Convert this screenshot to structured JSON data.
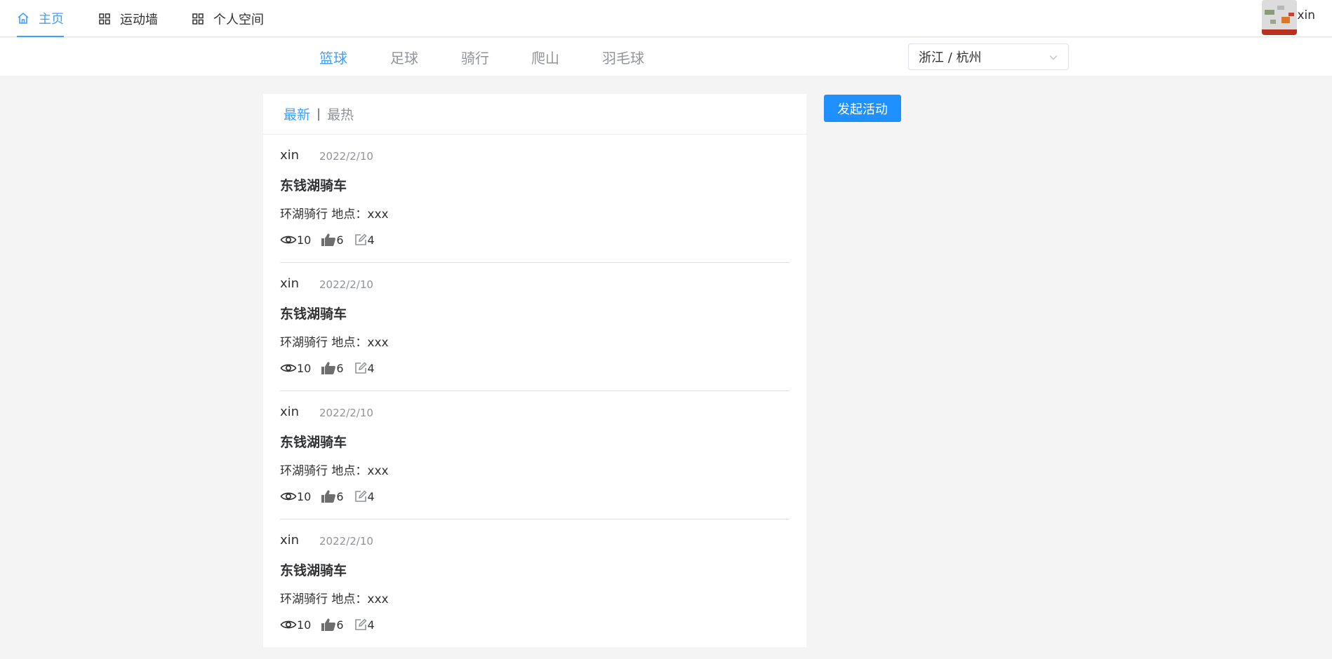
{
  "nav": {
    "items": [
      {
        "label": "主页",
        "icon": "home-icon",
        "active": true
      },
      {
        "label": "运动墙",
        "icon": "grid-icon",
        "active": false
      },
      {
        "label": "个人空间",
        "icon": "grid-icon",
        "active": false
      }
    ]
  },
  "user": {
    "name": "xin"
  },
  "sports": {
    "tabs": [
      "篮球",
      "足球",
      "骑行",
      "爬山",
      "羽毛球"
    ],
    "active_index": 0
  },
  "region": {
    "value": "浙江 / 杭州"
  },
  "sort": {
    "latest": "最新",
    "separator": "|",
    "hottest": "最热",
    "active": "latest"
  },
  "create_button": {
    "label": "发起活动"
  },
  "posts": [
    {
      "author": "xin",
      "date": "2022/2/10",
      "title": "东钱湖骑车",
      "desc": "环湖骑行 地点：xxx",
      "views": "10",
      "likes": "6",
      "comments": "4"
    },
    {
      "author": "xin",
      "date": "2022/2/10",
      "title": "东钱湖骑车",
      "desc": "环湖骑行 地点：xxx",
      "views": "10",
      "likes": "6",
      "comments": "4"
    },
    {
      "author": "xin",
      "date": "2022/2/10",
      "title": "东钱湖骑车",
      "desc": "环湖骑行 地点：xxx",
      "views": "10",
      "likes": "6",
      "comments": "4"
    },
    {
      "author": "xin",
      "date": "2022/2/10",
      "title": "东钱湖骑车",
      "desc": "环湖骑行 地点：xxx",
      "views": "10",
      "likes": "6",
      "comments": "4"
    }
  ],
  "colors": {
    "accent": "#409eff",
    "button": "#1e90ff",
    "background": "#f4f4f4"
  }
}
